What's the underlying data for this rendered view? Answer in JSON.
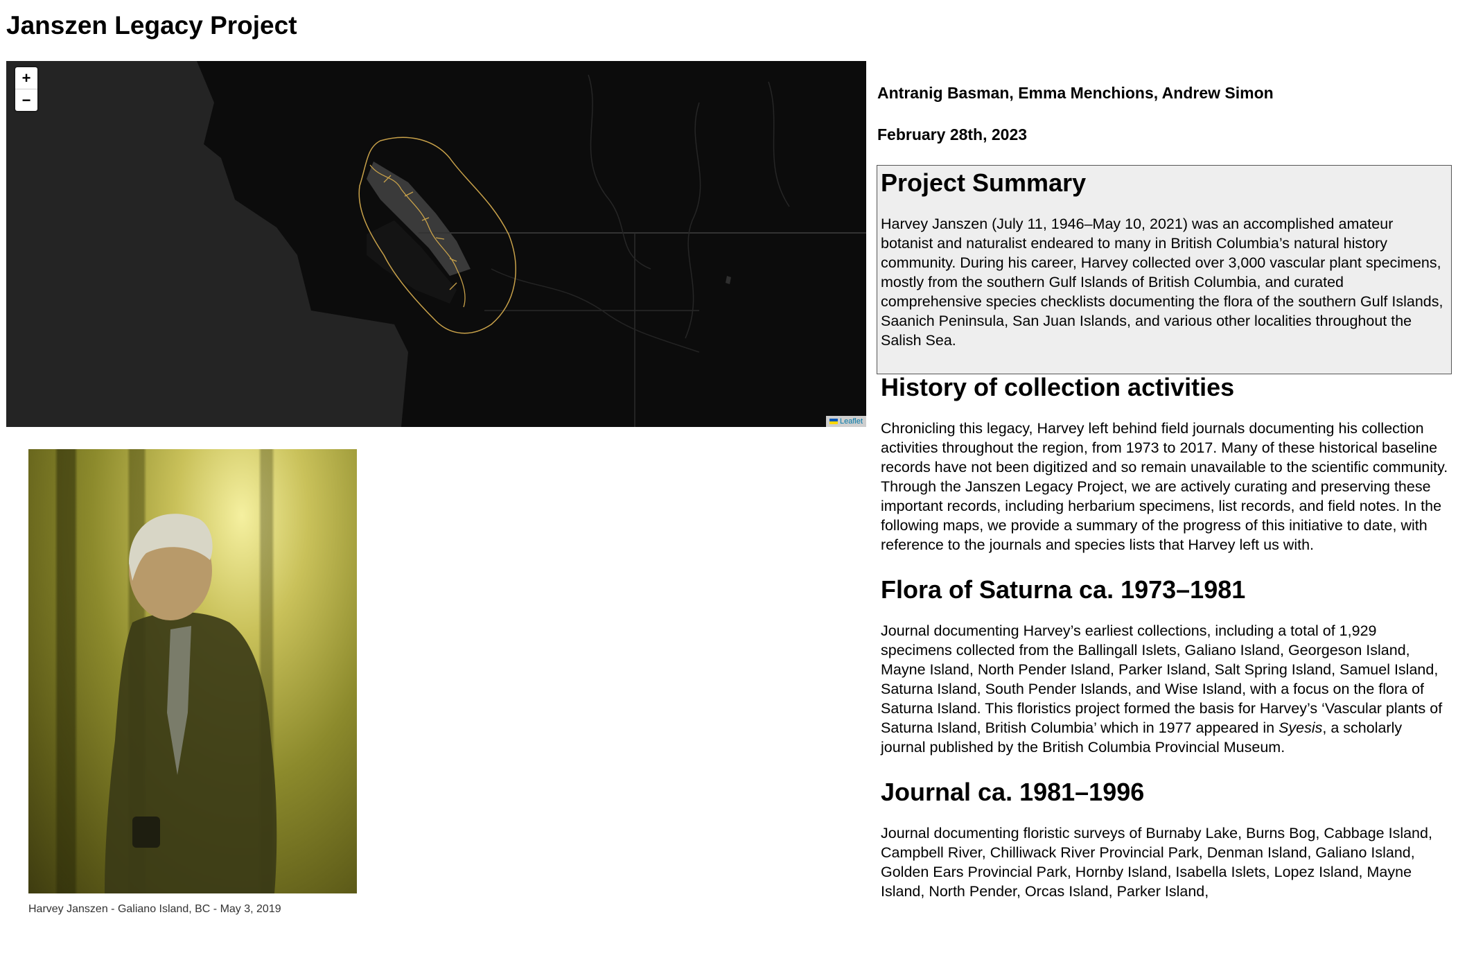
{
  "page": {
    "title": "Janszen Legacy Project"
  },
  "map": {
    "zoom_in_label": "+",
    "zoom_out_label": "−",
    "attribution": "Leaflet",
    "boundary_color": "#c9a24a",
    "background_color": "#0c0c0c"
  },
  "photo": {
    "caption": "Harvey Janszen - Galiano Island, BC - May 3, 2019"
  },
  "meta": {
    "authors": "Antranig Basman, Emma Menchions, Andrew Simon",
    "date": "February 28th, 2023"
  },
  "summary": {
    "heading": "Project Summary",
    "text": "Harvey Janszen (July 11, 1946–May 10, 2021) was an accomplished amateur botanist and naturalist endeared to many in British Columbia’s natural history community. During his career, Harvey collected over 3,000 vascular plant specimens, mostly from the southern Gulf Islands of British Columbia, and curated comprehensive species checklists documenting the flora of the southern Gulf Islands, Saanich Peninsula, San Juan Islands, and various other localities throughout the Salish Sea."
  },
  "sections": [
    {
      "heading": "History of collection activities",
      "text": "Chronicling this legacy, Harvey left behind field journals documenting his collection activities throughout the region, from 1973 to 2017. Many of these historical baseline records have not been digitized and so remain unavailable to the scientific community. Through the Janszen Legacy Project, we are actively curating and preserving these important records, including herbarium specimens, list records, and field notes. In the following maps, we provide a summary of the progress of this initiative to date, with reference to the journals and species lists that Harvey left us with."
    },
    {
      "heading": "Flora of Saturna ca. 1973–1981",
      "text_before": "Journal documenting Harvey’s earliest collections, including a total of 1,929 specimens collected from the Ballingall Islets, Galiano Island, Georgeson Island, Mayne Island, North Pender Island, Parker Island, Salt Spring Island, Samuel Island, Saturna Island, South Pender Islands, and Wise Island, with a focus on the flora of Saturna Island. This floristics project formed the basis for Harvey’s ‘Vascular plants of Saturna Island, British Columbia’ which in 1977 appeared in ",
      "text_italic": "Syesis",
      "text_after": ", a scholarly journal published by the British Columbia Provincial Museum."
    },
    {
      "heading": "Journal ca. 1981–1996",
      "text": "Journal documenting floristic surveys of Burnaby Lake, Burns Bog, Cabbage Island, Campbell River, Chilliwack River Provincial Park, Denman Island, Galiano Island, Golden Ears Provincial Park, Hornby Island, Isabella Islets, Lopez Island, Mayne Island, North Pender, Orcas Island, Parker Island,"
    }
  ]
}
